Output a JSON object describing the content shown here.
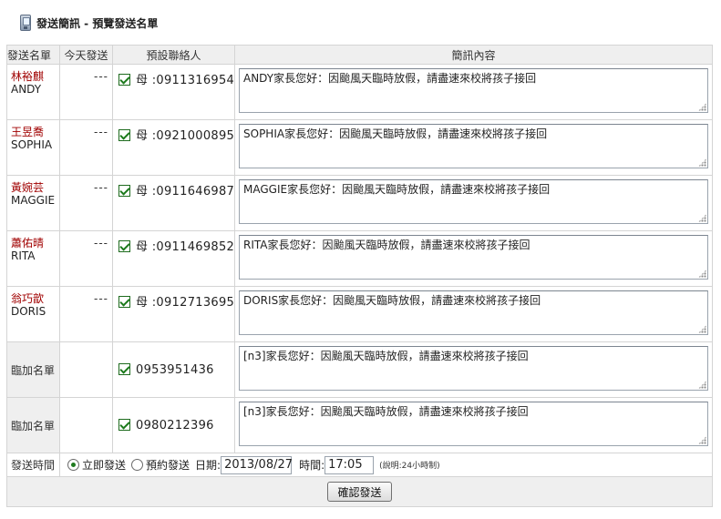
{
  "header": {
    "title": "發送簡訊 - 預覽發送名單",
    "icon": "mobile-phone-icon"
  },
  "table": {
    "headers": [
      "發送名單",
      "今天發送",
      "預設聯絡人",
      "簡訊內容"
    ],
    "students": [
      {
        "cn": "林裕麒",
        "en": "ANDY",
        "today": "---",
        "contact": "母 :0911316954",
        "message": "ANDY家長您好：因颱風天臨時放假，請盡速來校將孩子接回"
      },
      {
        "cn": "王昱喬",
        "en": "SOPHIA",
        "today": "---",
        "contact": "母 :0921000895",
        "message": "SOPHIA家長您好：因颱風天臨時放假，請盡速來校將孩子接回"
      },
      {
        "cn": "黃婉芸",
        "en": "MAGGIE",
        "today": "---",
        "contact": "母 :0911646987",
        "message": "MAGGIE家長您好：因颱風天臨時放假，請盡速來校將孩子接回"
      },
      {
        "cn": "蕭佑晴",
        "en": "RITA",
        "today": "---",
        "contact": "母 :0911469852",
        "message": "RITA家長您好：因颱風天臨時放假，請盡速來校將孩子接回"
      },
      {
        "cn": "翁巧歆",
        "en": "DORIS",
        "today": "---",
        "contact": "母 :0912713695",
        "message": "DORIS家長您好：因颱風天臨時放假，請盡速來校將孩子接回"
      }
    ],
    "temp": [
      {
        "label": "臨加名單",
        "contact": "0953951436",
        "message": "[n3]家長您好：因颱風天臨時放假，請盡速來校將孩子接回"
      },
      {
        "label": "臨加名單",
        "contact": "0980212396",
        "message": "[n3]家長您好：因颱風天臨時放假，請盡速來校將孩子接回"
      }
    ]
  },
  "send_time": {
    "label": "發送時間",
    "immediate_label": "立即發送",
    "scheduled_label": "預約發送",
    "date_label": "日期:",
    "date_value": "2013/08/27",
    "time_label": "時間:",
    "time_value": "17:05",
    "note": "(說明:24小時制)"
  },
  "submit": {
    "label": "確認發送"
  }
}
